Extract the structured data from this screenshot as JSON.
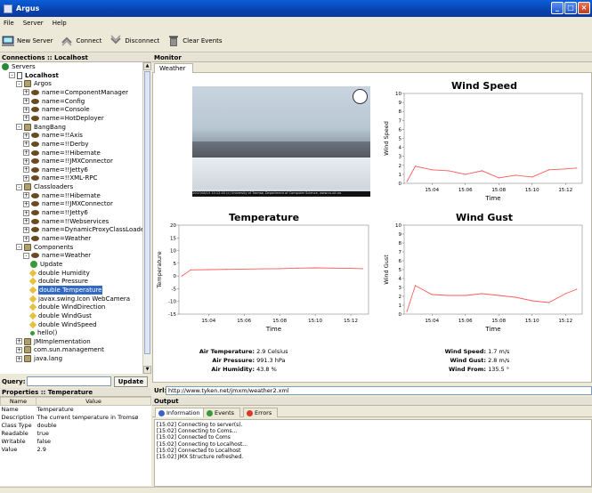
{
  "window": {
    "title": "Argus"
  },
  "menu": [
    "File",
    "Server",
    "Help"
  ],
  "toolbar": {
    "new_server": "New Server",
    "connect": "Connect",
    "disconnect": "Disconnect",
    "clear_events": "Clear Events"
  },
  "connections": {
    "header": "Connections :: Localhost",
    "tree": [
      {
        "label": "Servers",
        "level": 0,
        "icon": "servers-icon",
        "expander": ""
      },
      {
        "label": "Localhost",
        "level": 1,
        "icon": "host-icon",
        "expander": "-",
        "bold": true
      },
      {
        "label": "Argos",
        "level": 2,
        "icon": "package-icon",
        "expander": "-"
      },
      {
        "label": "name=ComponentManager",
        "level": 3,
        "icon": "mbean-icon",
        "expander": "+"
      },
      {
        "label": "name=Config",
        "level": 3,
        "icon": "mbean-icon",
        "expander": "+"
      },
      {
        "label": "name=Console",
        "level": 3,
        "icon": "mbean-icon",
        "expander": "+"
      },
      {
        "label": "name=HotDeployer",
        "level": 3,
        "icon": "mbean-icon",
        "expander": "+"
      },
      {
        "label": "BangBang",
        "level": 2,
        "icon": "package-icon",
        "expander": "-"
      },
      {
        "label": "name=!!Axis",
        "level": 3,
        "icon": "mbean-icon",
        "expander": "+"
      },
      {
        "label": "name=!!Derby",
        "level": 3,
        "icon": "mbean-icon",
        "expander": "+"
      },
      {
        "label": "name=!!Hibernate",
        "level": 3,
        "icon": "mbean-icon",
        "expander": "+"
      },
      {
        "label": "name=!!JMXConnector",
        "level": 3,
        "icon": "mbean-icon",
        "expander": "+"
      },
      {
        "label": "name=!!Jetty6",
        "level": 3,
        "icon": "mbean-icon",
        "expander": "+"
      },
      {
        "label": "name=!!XML-RPC",
        "level": 3,
        "icon": "mbean-icon",
        "expander": "+"
      },
      {
        "label": "Classloaders",
        "level": 2,
        "icon": "package-icon",
        "expander": "-"
      },
      {
        "label": "name=!!Hibernate",
        "level": 3,
        "icon": "mbean-icon",
        "expander": "+"
      },
      {
        "label": "name=!!JMXConnector",
        "level": 3,
        "icon": "mbean-icon",
        "expander": "+"
      },
      {
        "label": "name=!!Jetty6",
        "level": 3,
        "icon": "mbean-icon",
        "expander": "+"
      },
      {
        "label": "name=!!Webservices",
        "level": 3,
        "icon": "mbean-icon",
        "expander": "+"
      },
      {
        "label": "name=DynamicProxyClassLoader",
        "level": 3,
        "icon": "mbean-icon",
        "expander": "+"
      },
      {
        "label": "name=Weather",
        "level": 3,
        "icon": "mbean-icon",
        "expander": "+"
      },
      {
        "label": "Components",
        "level": 2,
        "icon": "package-icon",
        "expander": "-"
      },
      {
        "label": "name=Weather",
        "level": 3,
        "icon": "mbean-icon",
        "expander": "-"
      },
      {
        "label": "Update",
        "level": 4,
        "icon": "operation-icon",
        "expander": ""
      },
      {
        "label": "double Humidity",
        "level": 4,
        "icon": "attribute-icon",
        "expander": ""
      },
      {
        "label": "double Pressure",
        "level": 4,
        "icon": "attribute-icon",
        "expander": ""
      },
      {
        "label": "double Temperature",
        "level": 4,
        "icon": "attribute-icon",
        "expander": "",
        "selected": true
      },
      {
        "label": "javax.swing.Icon WebCamera",
        "level": 4,
        "icon": "attribute-icon",
        "expander": ""
      },
      {
        "label": "double WindDirection",
        "level": 4,
        "icon": "attribute-icon",
        "expander": ""
      },
      {
        "label": "double WindGust",
        "level": 4,
        "icon": "attribute-icon",
        "expander": ""
      },
      {
        "label": "double WindSpeed",
        "level": 4,
        "icon": "attribute-icon",
        "expander": ""
      },
      {
        "label": "hello()",
        "level": 4,
        "icon": "method-icon",
        "expander": ""
      },
      {
        "label": "JMImplementation",
        "level": 2,
        "icon": "package-icon",
        "expander": "+"
      },
      {
        "label": "com.sun.management",
        "level": 2,
        "icon": "package-icon",
        "expander": "+"
      },
      {
        "label": "java.lang",
        "level": 2,
        "icon": "package-icon",
        "expander": "+"
      }
    ]
  },
  "query": {
    "label": "Query:",
    "value": "",
    "button": "Update"
  },
  "properties": {
    "header": "Properties :: Temperature",
    "columns": [
      "Name",
      "Value"
    ],
    "rows": [
      [
        "Name",
        "Temperature"
      ],
      [
        "Description",
        "The current temperature in Tromsø"
      ],
      [
        "Class Type",
        "double"
      ],
      [
        "Readable",
        "true"
      ],
      [
        "Writable",
        "false"
      ],
      [
        "Value",
        "2.9"
      ]
    ]
  },
  "monitor": {
    "header": "Monitor",
    "tab": "Weather",
    "camera_caption": "2007/08/15 15:12:40  (c) University of Tromsø, Department of Computer Science, www.cs.uit.no"
  },
  "chart_data": [
    {
      "type": "line",
      "title": "Wind Speed",
      "xlabel": "Time",
      "ylabel": "Wind Speed",
      "x": [
        "15:02:30",
        "15:03:00",
        "15:04:00",
        "15:05:00",
        "15:06:00",
        "15:07:00",
        "15:08:00",
        "15:09:00",
        "15:10:00",
        "15:11:00",
        "15:12:00",
        "15:12:40"
      ],
      "xlim": [
        "15:02:20",
        "15:13:00"
      ],
      "xticks": [
        "15:04",
        "15:06",
        "15:08",
        "15:10",
        "15:12"
      ],
      "ylim": [
        0,
        10
      ],
      "yticks": [
        0,
        1,
        2,
        3,
        4,
        5,
        6,
        7,
        8,
        9,
        10
      ],
      "series": [
        {
          "values": [
            0.2,
            1.9,
            1.5,
            1.4,
            1.0,
            1.4,
            0.6,
            0.9,
            0.7,
            1.5,
            1.6,
            1.7
          ]
        }
      ],
      "color": "#ff5a5a"
    },
    {
      "type": "line",
      "title": "Temperature",
      "xlabel": "Time",
      "ylabel": "Temperature",
      "x": [
        "15:02:30",
        "15:03:00",
        "15:04:00",
        "15:05:00",
        "15:06:00",
        "15:07:00",
        "15:08:00",
        "15:09:00",
        "15:10:00",
        "15:11:00",
        "15:12:00",
        "15:12:40"
      ],
      "xlim": [
        "15:02:20",
        "15:13:00"
      ],
      "xticks": [
        "15:04",
        "15:06",
        "15:08",
        "15:10",
        "15:12"
      ],
      "ylim": [
        -15,
        20
      ],
      "yticks": [
        -15,
        -10,
        -5,
        0,
        5,
        10,
        15,
        20
      ],
      "series": [
        {
          "values": [
            0.0,
            2.4,
            2.5,
            2.6,
            2.7,
            2.8,
            2.9,
            3.1,
            3.2,
            3.1,
            3.0,
            2.9
          ]
        }
      ],
      "color": "#ff5a5a"
    },
    {
      "type": "line",
      "title": "Wind Gust",
      "xlabel": "Time",
      "ylabel": "Wind Gust",
      "x": [
        "15:02:30",
        "15:03:00",
        "15:04:00",
        "15:05:00",
        "15:06:00",
        "15:07:00",
        "15:08:00",
        "15:09:00",
        "15:10:00",
        "15:11:00",
        "15:12:00",
        "15:12:40"
      ],
      "xlim": [
        "15:02:20",
        "15:13:00"
      ],
      "xticks": [
        "15:04",
        "15:06",
        "15:08",
        "15:10",
        "15:12"
      ],
      "ylim": [
        0,
        10
      ],
      "yticks": [
        0,
        1,
        2,
        3,
        4,
        5,
        6,
        7,
        8,
        9,
        10
      ],
      "series": [
        {
          "values": [
            0.3,
            3.2,
            2.2,
            2.1,
            2.1,
            2.3,
            2.1,
            1.9,
            1.5,
            1.3,
            2.3,
            2.8
          ]
        }
      ],
      "color": "#ff5a5a"
    }
  ],
  "readings": {
    "left": [
      {
        "label": "Air Temperature:",
        "value": "2.9 Celsius"
      },
      {
        "label": "Air Pressure:",
        "value": "991.3 hPa"
      },
      {
        "label": "Air Humidity:",
        "value": "43.8 %"
      }
    ],
    "right": [
      {
        "label": "Wind Speed:",
        "value": "1.7 m/s"
      },
      {
        "label": "Wind Gust:",
        "value": "2.8 m/s"
      },
      {
        "label": "Wind From:",
        "value": "135.5 °"
      }
    ]
  },
  "url": {
    "label": "Url:",
    "value": "http://www.tyken.net/jmxm/weather2.xml"
  },
  "output": {
    "header": "Output",
    "tabs": [
      "Information",
      "Events",
      "Errors"
    ],
    "lines": [
      "[15:02] Connecting to server(s).",
      "[15:02] Connecting to Coms...",
      "[15:02] Connected to Coms",
      "[15:02] Connecting to Localhost...",
      "[15:02] Connected to Localhost",
      "[15:02] JMX Structure refreshed."
    ]
  }
}
